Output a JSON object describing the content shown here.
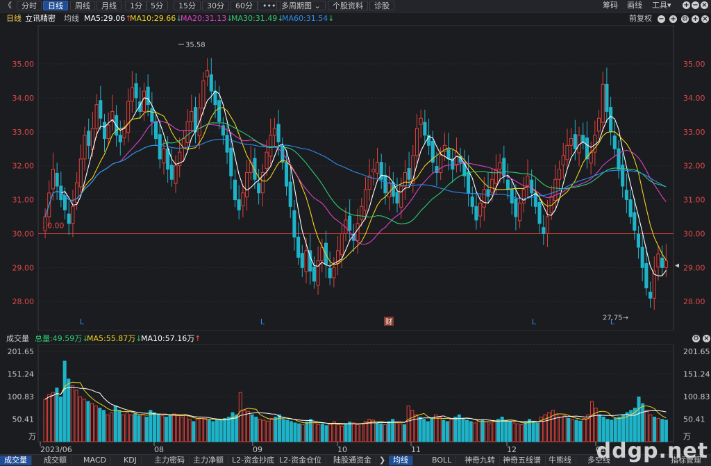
{
  "toolbar": {
    "back": "《",
    "tabs": [
      "分时",
      "日线",
      "周线",
      "月线",
      "1分",
      "5分",
      "15分",
      "30分",
      "60分",
      "•••",
      "多周期图 ⌄",
      "个股资料",
      "诊股"
    ],
    "active_tab": 1,
    "right": [
      "筹码",
      "画线",
      "工具▾"
    ]
  },
  "info": {
    "period": "日线",
    "stock": "立讯精密",
    "ma_label": "均线",
    "ma5": "MA5:29.06",
    "ma10": "MA10:29.66",
    "ma20": "MA20:31.13",
    "ma30": "MA30:31.49",
    "ma60": "MA60:31.54",
    "ma5_arrow": "↑",
    "ma10_arrow": "↓",
    "ma20_arrow": "↓",
    "ma30_arrow": "↓",
    "ma60_arrow": "↓",
    "adjust": "前复权",
    "ma5_color": "#ffffff",
    "ma10_color": "#f2d21c",
    "ma20_color": "#e040c8",
    "ma30_color": "#2ecc71",
    "ma60_color": "#2d8cf0"
  },
  "volume_header": {
    "label": "成交量",
    "total": "总量:49.59万",
    "total_arrow": "↓",
    "ma5": "MA5:55.87万",
    "ma5_arrow": "↓",
    "ma10": "MA10:57.16万",
    "ma10_arrow": "↑"
  },
  "bottom_tabs": [
    "成交量",
    "成交额",
    "MACD",
    "KDJ",
    "主力密码",
    "主力净额",
    "L2-资金抄底",
    "L2-资金仓位",
    "陆股通资金"
  ],
  "bottom_tabs_right": [
    "均线",
    "BOLL",
    "神奇九转",
    "神奇五线谱",
    "牛熊线",
    "多空线",
    "指标管理"
  ],
  "annotations": {
    "high": "35.58",
    "low": "27.75",
    "start_level": "30.00",
    "cai": "财",
    "l_marker": "L"
  },
  "watermark": "ddgp.net",
  "chart_data": {
    "type": "candlestick",
    "price_axis": {
      "ticks": [
        "35.00",
        "34.00",
        "33.00",
        "32.00",
        "31.00",
        "30.00",
        "29.00",
        "28.00"
      ],
      "min": 27.35,
      "max": 35.9
    },
    "volume_axis": {
      "ticks": [
        "201.65",
        "151.24",
        "100.83",
        "50.41"
      ],
      "unit": "万"
    },
    "x_labels": [
      "2023/06",
      "08",
      "09",
      "10",
      "11",
      "12",
      "01"
    ],
    "reference_line": 30.0,
    "high_mark": 35.58,
    "low_mark": 27.75,
    "close_series": [
      30.5,
      31.2,
      31.9,
      31.4,
      31.0,
      30.7,
      30.3,
      30.8,
      31.5,
      32.2,
      32.9,
      32.6,
      33.1,
      33.8,
      33.4,
      32.8,
      33.2,
      33.6,
      32.9,
      32.7,
      33.1,
      33.9,
      34.3,
      34.0,
      33.6,
      34.2,
      33.8,
      33.3,
      32.8,
      32.2,
      32.5,
      31.9,
      31.6,
      32.0,
      32.4,
      32.8,
      33.3,
      33.6,
      33.0,
      33.7,
      34.5,
      34.8,
      34.2,
      33.8,
      33.3,
      32.9,
      32.4,
      31.7,
      31.0,
      30.7,
      31.2,
      31.8,
      32.1,
      31.6,
      31.2,
      31.8,
      32.4,
      32.9,
      33.1,
      32.7,
      32.1,
      31.4,
      30.8,
      29.9,
      29.3,
      29.0,
      29.5,
      28.9,
      28.6,
      29.2,
      29.6,
      29.1,
      28.7,
      29.0,
      29.5,
      30.0,
      30.4,
      30.1,
      29.8,
      30.3,
      30.8,
      31.3,
      31.7,
      31.9,
      32.1,
      31.6,
      31.2,
      31.5,
      31.1,
      30.9,
      31.4,
      31.8,
      31.6,
      32.3,
      33.1,
      33.4,
      32.9,
      32.6,
      32.1,
      31.8,
      32.3,
      32.6,
      32.2,
      31.9,
      32.4,
      32.1,
      31.7,
      31.2,
      30.8,
      30.4,
      30.9,
      31.3,
      31.1,
      31.6,
      31.9,
      32.1,
      31.7,
      31.3,
      30.9,
      30.5,
      30.9,
      31.3,
      31.7,
      31.2,
      30.8,
      30.3,
      30.0,
      30.5,
      31.1,
      31.6,
      31.9,
      32.3,
      32.6,
      32.8,
      32.5,
      32.9,
      32.7,
      32.2,
      32.4,
      32.9,
      33.4,
      34.4,
      33.6,
      33.0,
      32.5,
      31.9,
      31.4,
      31.0,
      30.5,
      30.1,
      29.6,
      29.0,
      28.4,
      28.1,
      28.9,
      29.4,
      29.0,
      29.2
    ],
    "volume_series": [
      95,
      105,
      110,
      120,
      100,
      180,
      140,
      125,
      115,
      100,
      95,
      90,
      85,
      80,
      75,
      70,
      60,
      65,
      80,
      70,
      60,
      65,
      60,
      62,
      58,
      60,
      55,
      70,
      65,
      60,
      58,
      55,
      60,
      62,
      58,
      55,
      60,
      50,
      45,
      50,
      55,
      52,
      48,
      45,
      48,
      50,
      52,
      55,
      65,
      60,
      110,
      70,
      68,
      60,
      55,
      50,
      48,
      46,
      52,
      55,
      60,
      50,
      48,
      45,
      42,
      40,
      38,
      44,
      50,
      42,
      38,
      40,
      36,
      40,
      45,
      38,
      35,
      40,
      44,
      42,
      38,
      40,
      45,
      50,
      48,
      42,
      40,
      38,
      45,
      50,
      42,
      40,
      38,
      80,
      70,
      60,
      55,
      50,
      45,
      52,
      60,
      55,
      48,
      45,
      50,
      55,
      60,
      52,
      48,
      45,
      42,
      45,
      48,
      44,
      40,
      46,
      50,
      55,
      48,
      45,
      42,
      40,
      38,
      44,
      50,
      46,
      42,
      55,
      60,
      65,
      70,
      60,
      55,
      58,
      52,
      50,
      48,
      46,
      52,
      60,
      90,
      75,
      60,
      55,
      50,
      48,
      52,
      55,
      60,
      65,
      70,
      75,
      100,
      85,
      70,
      60,
      55,
      52,
      50,
      48
    ]
  }
}
